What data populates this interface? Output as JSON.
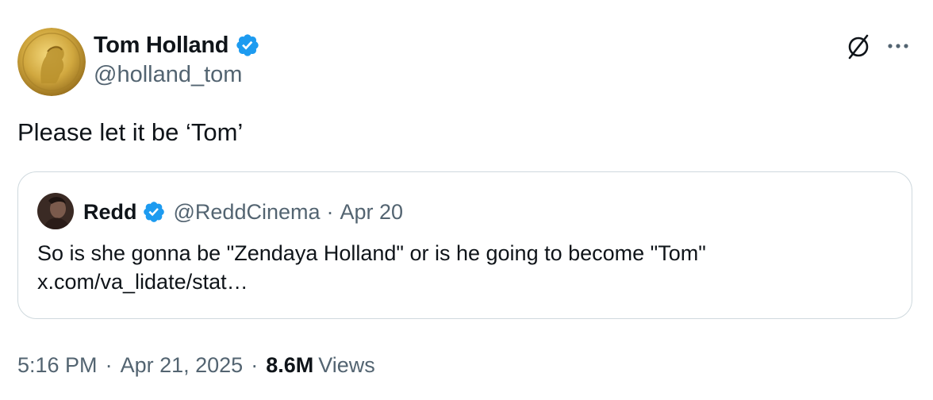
{
  "author": {
    "display_name": "Tom Holland",
    "handle": "@holland_tom",
    "avatar_icon": "gold-coin-avatar",
    "verified": true
  },
  "actions": {
    "grok_icon": "slashed-circle-icon",
    "more_icon": "more-dots-icon"
  },
  "tweet": {
    "text": "Please let it be ‘Tom’"
  },
  "quoted": {
    "display_name": "Redd",
    "handle": "@ReddCinema",
    "separator": "·",
    "date": "Apr 20",
    "verified": true,
    "line1": "So is she gonna be \"Zendaya Holland\" or is he going to become \"Tom\"",
    "line2": "x.com/va_lidate/stat…"
  },
  "meta": {
    "time": "5:16 PM",
    "separator": "·",
    "date": "Apr 21, 2025",
    "views_count": "8.6M",
    "views_label": "Views"
  },
  "colors": {
    "verified_blue": "#1d9bf0",
    "secondary_text": "#536471",
    "border": "#cfd9de",
    "gold": "#c9a23a"
  }
}
